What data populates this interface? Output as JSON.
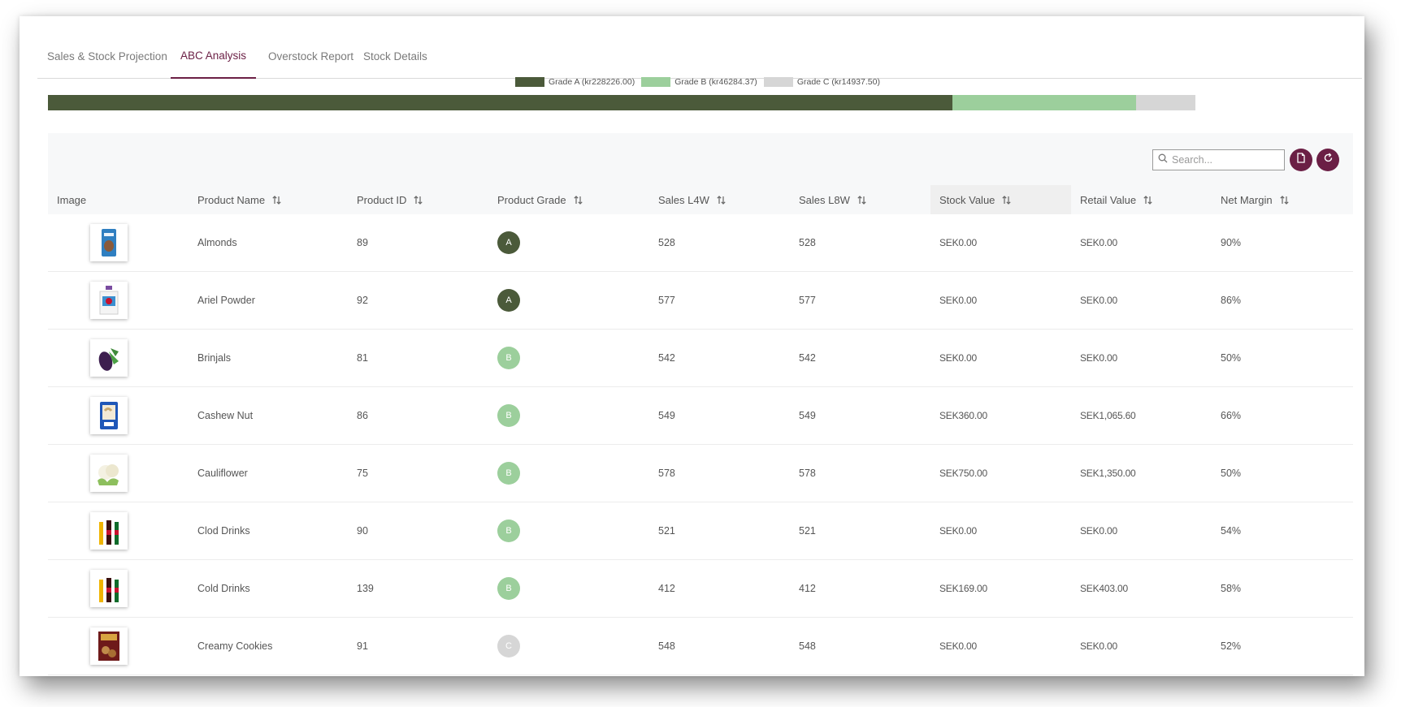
{
  "tabs": [
    {
      "label": "Sales & Stock Projection",
      "active": false
    },
    {
      "label": "ABC Analysis",
      "active": true
    },
    {
      "label": "Overstock Report",
      "active": false
    },
    {
      "label": "Stock Details",
      "active": false
    }
  ],
  "colors": {
    "accent": "#6b1f45",
    "grade_a": "#4b5a3a",
    "grade_b": "#9ccf9c",
    "grade_c": "#d6d6d6"
  },
  "chart_data": {
    "type": "bar",
    "stacked": true,
    "orientation": "horizontal",
    "series": [
      {
        "name": "Grade A (kr228226.00)",
        "value": 228226.0,
        "color": "#4b5a3a"
      },
      {
        "name": "Grade B (kr46284.37)",
        "value": 46284.37,
        "color": "#9ccf9c"
      },
      {
        "name": "Grade C (kr14937.50)",
        "value": 14937.5,
        "color": "#d6d6d6"
      }
    ]
  },
  "search": {
    "placeholder": "Search..."
  },
  "actions": {
    "export_icon": "file-icon",
    "refresh_icon": "refresh-icon"
  },
  "columns": [
    {
      "label": "Image",
      "sortable": false
    },
    {
      "label": "Product Name",
      "sortable": true
    },
    {
      "label": "Product ID",
      "sortable": true
    },
    {
      "label": "Product Grade",
      "sortable": true
    },
    {
      "label": "Sales L4W",
      "sortable": true
    },
    {
      "label": "Sales L8W",
      "sortable": true
    },
    {
      "label": "Stock Value",
      "sortable": true,
      "highlight": true
    },
    {
      "label": "Retail Value",
      "sortable": true
    },
    {
      "label": "Net Margin",
      "sortable": true
    }
  ],
  "rows": [
    {
      "image": "almonds-pack",
      "name": "Almonds",
      "id": "89",
      "grade": "A",
      "sales_l4w": "528",
      "sales_l8w": "528",
      "stock_value": "SEK0.00",
      "retail_value": "SEK0.00",
      "net_margin": "90%"
    },
    {
      "image": "detergent-bottle",
      "name": "Ariel Powder",
      "id": "92",
      "grade": "A",
      "sales_l4w": "577",
      "sales_l8w": "577",
      "stock_value": "SEK0.00",
      "retail_value": "SEK0.00",
      "net_margin": "86%"
    },
    {
      "image": "eggplant",
      "name": "Brinjals",
      "id": "81",
      "grade": "B",
      "sales_l4w": "542",
      "sales_l8w": "542",
      "stock_value": "SEK0.00",
      "retail_value": "SEK0.00",
      "net_margin": "50%"
    },
    {
      "image": "cashew-pack",
      "name": "Cashew Nut",
      "id": "86",
      "grade": "B",
      "sales_l4w": "549",
      "sales_l8w": "549",
      "stock_value": "SEK360.00",
      "retail_value": "SEK1,065.60",
      "net_margin": "66%"
    },
    {
      "image": "cauliflower",
      "name": "Cauliflower",
      "id": "75",
      "grade": "B",
      "sales_l4w": "578",
      "sales_l8w": "578",
      "stock_value": "SEK750.00",
      "retail_value": "SEK1,350.00",
      "net_margin": "50%"
    },
    {
      "image": "soda-bottles",
      "name": "Clod Drinks",
      "id": "90",
      "grade": "B",
      "sales_l4w": "521",
      "sales_l8w": "521",
      "stock_value": "SEK0.00",
      "retail_value": "SEK0.00",
      "net_margin": "54%"
    },
    {
      "image": "soda-bottles",
      "name": "Cold Drinks",
      "id": "139",
      "grade": "B",
      "sales_l4w": "412",
      "sales_l8w": "412",
      "stock_value": "SEK169.00",
      "retail_value": "SEK403.00",
      "net_margin": "58%"
    },
    {
      "image": "cookies-box",
      "name": "Creamy Cookies",
      "id": "91",
      "grade": "C",
      "sales_l4w": "548",
      "sales_l8w": "548",
      "stock_value": "SEK0.00",
      "retail_value": "SEK0.00",
      "net_margin": "52%"
    }
  ]
}
